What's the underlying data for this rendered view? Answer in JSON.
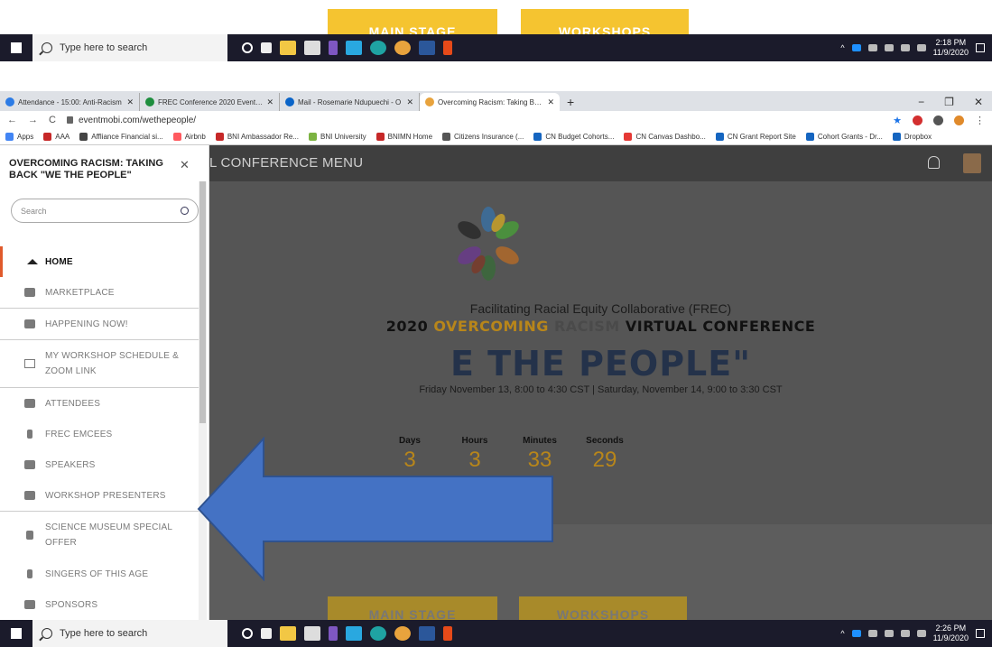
{
  "top_band": {
    "btn1": "MAIN STAGE",
    "btn2": "WORKSHOPS"
  },
  "taskbar_top": {
    "search": "Type here to search",
    "time": "2:18 PM",
    "date": "11/9/2020"
  },
  "taskbar_bottom": {
    "search": "Type here to search",
    "time": "2:26 PM",
    "date": "11/9/2020"
  },
  "tabs": [
    {
      "title": "Attendance - 15:00: Anti-Racism",
      "color": "#2c7be5"
    },
    {
      "title": "FREC Conference 2020 Event Ma",
      "color": "#1e8e3e"
    },
    {
      "title": "Mail - Rosemarie Ndupuechi - O",
      "color": "#0a64c8"
    },
    {
      "title": "Overcoming Racism: Taking Back",
      "color": "#e8a33d"
    }
  ],
  "browser": {
    "url": "eventmobi.com/wethepeople/"
  },
  "bookmarks": [
    {
      "label": "Apps",
      "color": "#4285f4"
    },
    {
      "label": "AAA",
      "color": "#c62828"
    },
    {
      "label": "Affliance Financial si...",
      "color": "#444444"
    },
    {
      "label": "Airbnb",
      "color": "#ff5a5f"
    },
    {
      "label": "BNI Ambassador Re...",
      "color": "#c62828"
    },
    {
      "label": "BNI University",
      "color": "#7cb342"
    },
    {
      "label": "BNIMN Home",
      "color": "#c62828"
    },
    {
      "label": "Citizens Insurance (...",
      "color": "#555555"
    },
    {
      "label": "CN Budget Cohorts...",
      "color": "#1565c0"
    },
    {
      "label": "CN Canvas Dashbo...",
      "color": "#e53935"
    },
    {
      "label": "CN Grant Report Site",
      "color": "#1565c0"
    },
    {
      "label": "Cohort Grants - Dr...",
      "color": "#1565c0"
    },
    {
      "label": "Dropbox",
      "color": "#1565c0"
    }
  ],
  "app": {
    "header_title": "L CONFERENCE MENU",
    "sidebar_title": "OVERCOMING RACISM: TAKING BACK \"WE THE PEOPLE\"",
    "search_placeholder": "Search",
    "menu": [
      {
        "label": "HOME",
        "icon": "home-icon"
      },
      {
        "label": "MARKETPLACE",
        "icon": "cart-icon"
      },
      {
        "label": "HAPPENING NOW!",
        "icon": "megaphone-icon"
      },
      {
        "label": "MY WORKSHOP SCHEDULE & ZOOM LINK",
        "icon": "calendar-icon"
      },
      {
        "label": "ATTENDEES",
        "icon": "people-icon"
      },
      {
        "label": "FREC EMCEES",
        "icon": "microphone-icon"
      },
      {
        "label": "SPEAKERS",
        "icon": "people-icon"
      },
      {
        "label": "WORKSHOP PRESENTERS",
        "icon": "people-icon"
      },
      {
        "label": "SCIENCE MUSEUM SPECIAL OFFER",
        "icon": "flask-icon"
      },
      {
        "label": "SINGERS OF THIS AGE",
        "icon": "microphone-icon"
      },
      {
        "label": "SPONSORS",
        "icon": "flag-icon"
      }
    ],
    "hero": {
      "subtitle": "Facilitating Racial Equity Collaborative (FREC)",
      "title_year": "2020 ",
      "title_h1": "OVERCOMING",
      "title_h2": " RACISM",
      "title_rest": " VIRTUAL CONFERENCE",
      "tagline": "E THE PEOPLE\"",
      "dates": "Friday November 13, 8:00 to 4:30 CST | Saturday, November 14, 9:00 to 3:30 CST"
    },
    "countdown": [
      {
        "label": "Days",
        "value": "3"
      },
      {
        "label": "Hours",
        "value": "3"
      },
      {
        "label": "Minutes",
        "value": "33"
      },
      {
        "label": "Seconds",
        "value": "29"
      }
    ],
    "bottom_buttons": {
      "btn1": "MAIN STAGE",
      "btn2": "WORKSHOPS"
    }
  },
  "colors": {
    "accent_gold": "#b8861a",
    "arrow_blue": "#4472c4",
    "active_marker": "#e05a2b"
  }
}
